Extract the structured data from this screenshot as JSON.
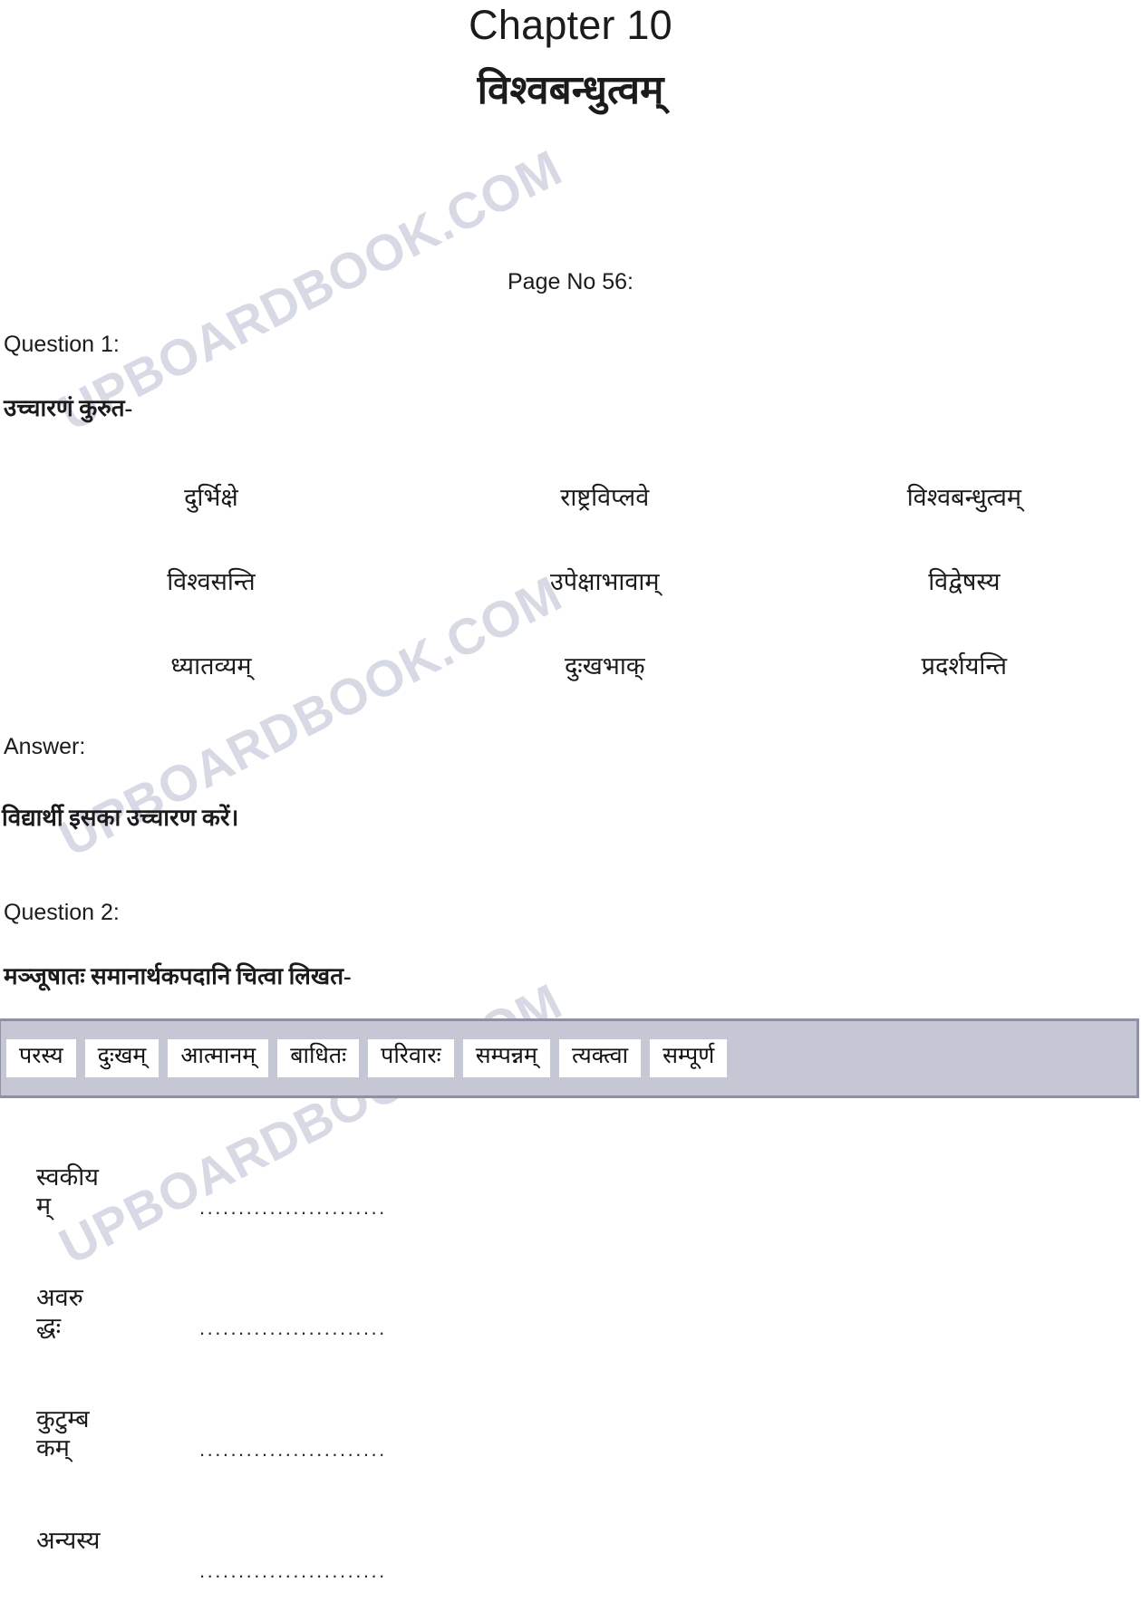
{
  "watermark": {
    "text": "UPBOARDBOOK.COM",
    "color": "#c9cbdb",
    "occurrences": 3
  },
  "header": {
    "chapter": "Chapter 10",
    "lesson_title": "विश्वबन्धुत्वम्",
    "page_no": "Page No 56:"
  },
  "question1": {
    "label": "Question 1:",
    "prompt": "उच्चारणं कुरुत-",
    "words": [
      [
        "दुर्भिक्षे",
        "राष्ट्रविप्लवे",
        "विश्वबन्धुत्वम्"
      ],
      [
        "विश्वसन्ति",
        "उपेक्षाभावाम्",
        "विद्वेषस्य"
      ],
      [
        "ध्यातव्यम्",
        "दुःखभाक्",
        "प्रदर्शयन्ति"
      ]
    ],
    "answer_label": "Answer:",
    "answer_text": "विद्यार्थी इसका उच्चारण करें।"
  },
  "question2": {
    "label": "Question 2:",
    "prompt": "मञ्जूषातः समानार्थकपदानि चित्वा लिखत-",
    "manjusha": {
      "background_color": "#c6c7d4",
      "border_color": "#8f90a3",
      "words": [
        "परस्य",
        "दुःखम्",
        "आत्मानम्",
        "बाधितः",
        "परिवारः",
        "सम्पन्नम्",
        "त्यक्त्वा",
        "सम्पूर्ण"
      ]
    },
    "fill_rows": [
      {
        "word_line1": "स्वकीय",
        "word_line2": "म्",
        "dots": "........................"
      },
      {
        "word_line1": "अवरु",
        "word_line2": "द्धः",
        "dots": "........................"
      },
      {
        "word_line1": "कुटुम्ब",
        "word_line2": "कम्",
        "dots": "........................"
      },
      {
        "word_line1": "अन्यस्य",
        "word_line2": "",
        "dots": "........................"
      }
    ]
  }
}
